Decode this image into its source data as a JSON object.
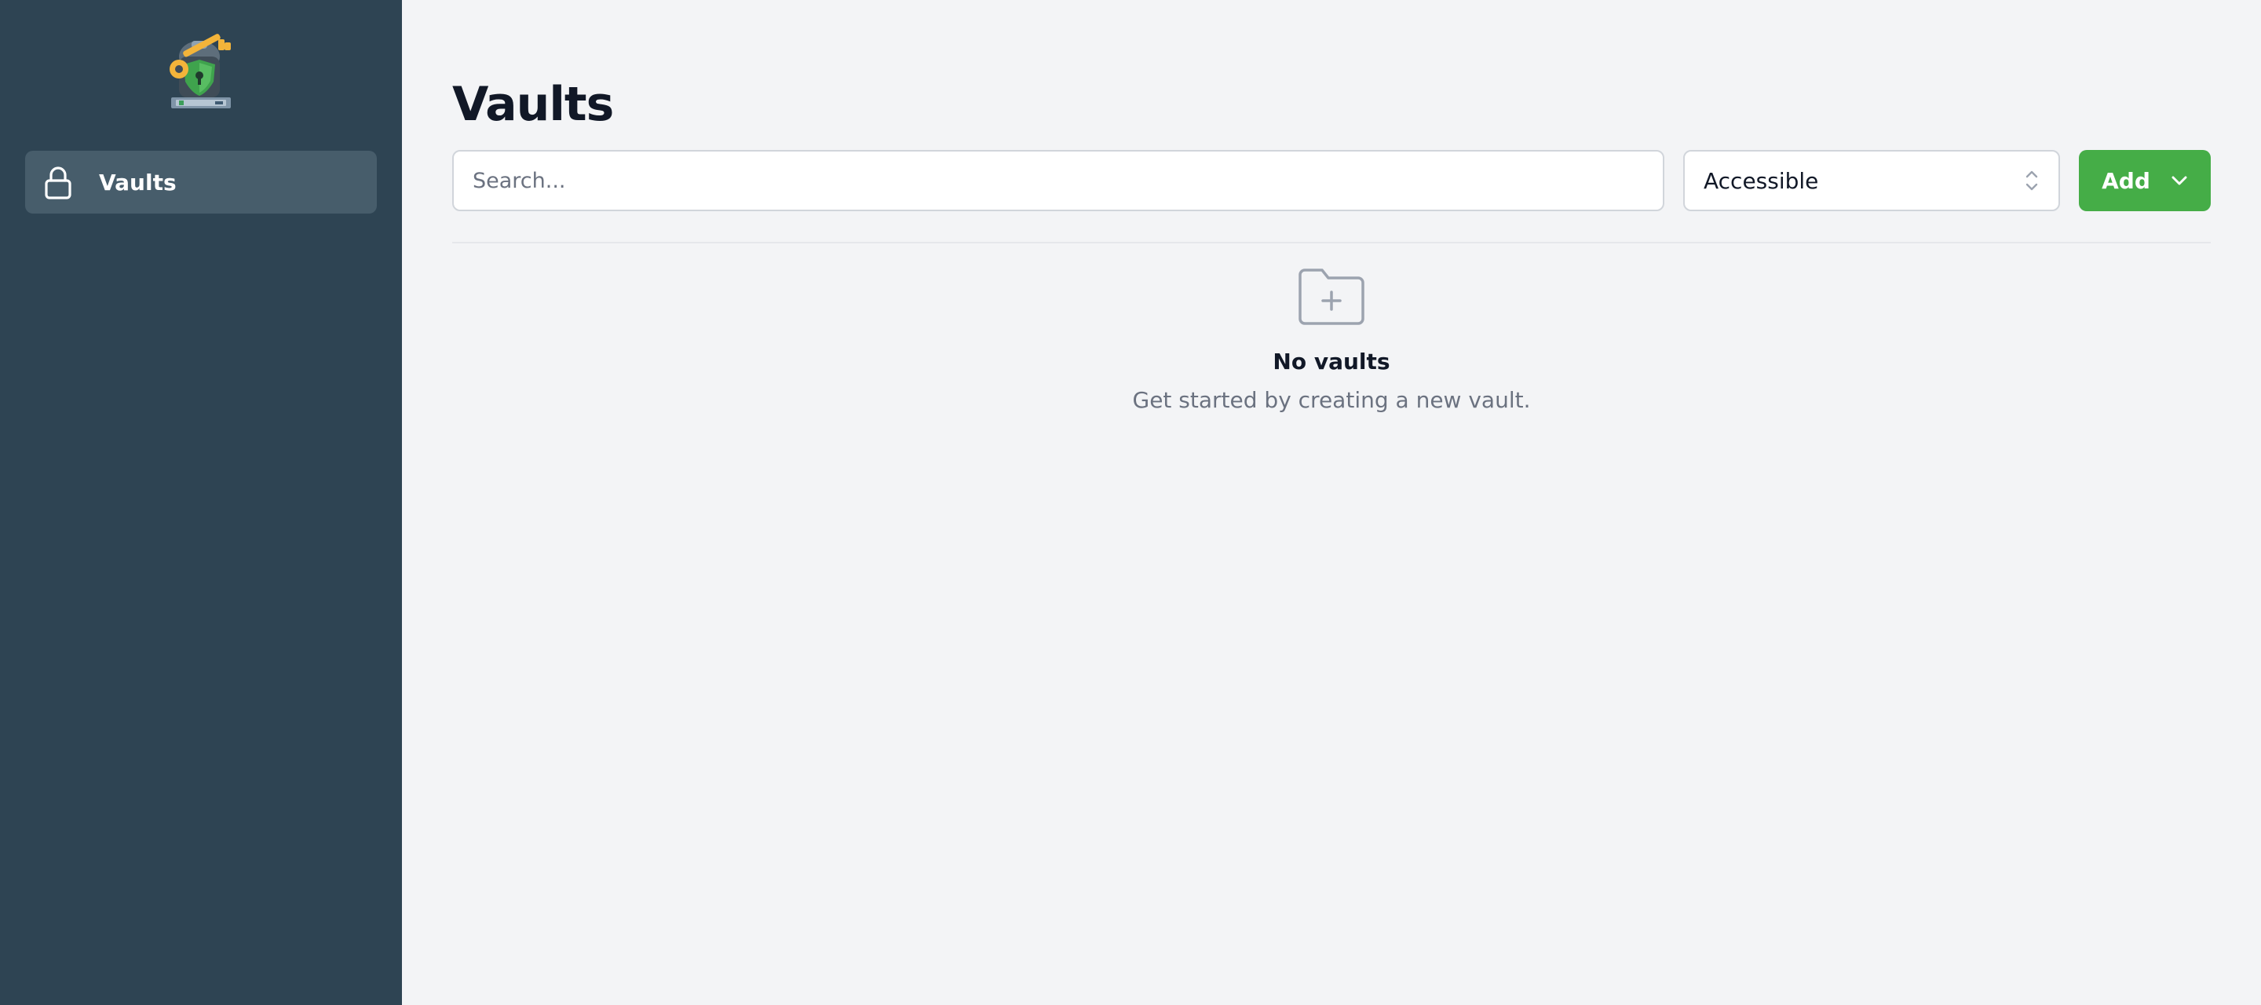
{
  "sidebar": {
    "logo": {
      "icon": "vault-key-logo-icon"
    },
    "items": [
      {
        "label": "Vaults",
        "icon": "lock-icon",
        "active": true
      }
    ]
  },
  "main": {
    "title": "Vaults",
    "search": {
      "placeholder": "Search...",
      "value": ""
    },
    "filter": {
      "selected": "Accessible",
      "icon": "chevron-up-down-icon"
    },
    "add_button": {
      "label": "Add",
      "icon": "chevron-down-icon"
    },
    "empty_state": {
      "icon": "folder-plus-icon",
      "heading": "No vaults",
      "description": "Get started by creating a new vault."
    }
  },
  "colors": {
    "sidebar_bg": "#2e4453",
    "sidebar_active": "#475d6b",
    "main_bg": "#f3f4f6",
    "accent_green": "#45ad47",
    "text_primary": "#111827",
    "text_muted": "#6b7280"
  }
}
